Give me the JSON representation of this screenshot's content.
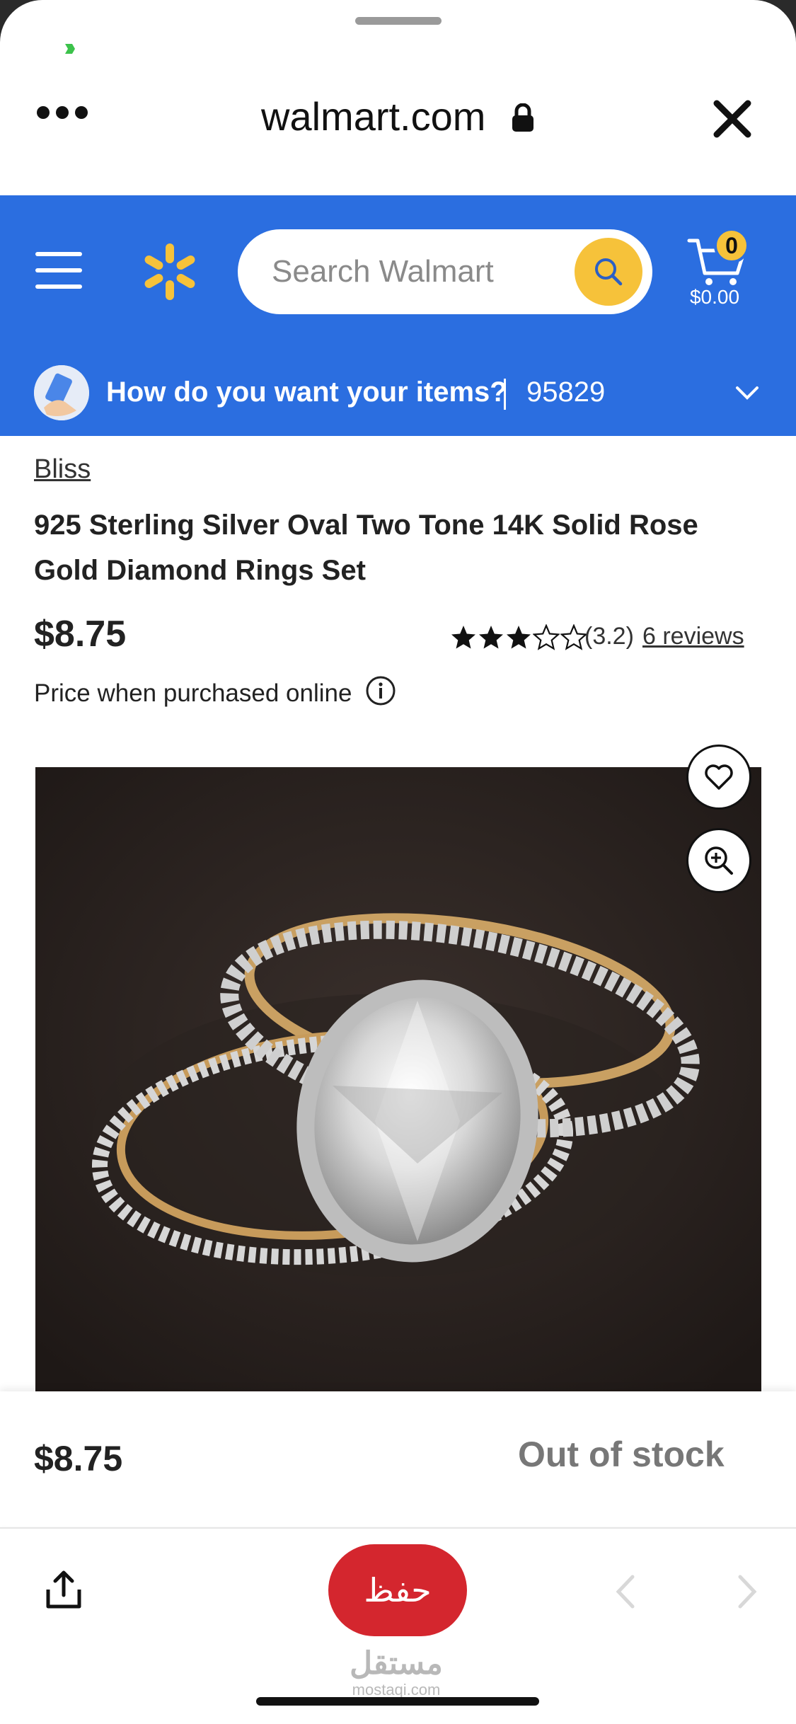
{
  "browser": {
    "url": "walmart.com",
    "more_icon": "more-dots-icon",
    "lock_icon": "lock-icon",
    "close_icon": "close-icon"
  },
  "header": {
    "menu_icon": "hamburger-icon",
    "logo_icon": "walmart-spark-icon",
    "search": {
      "placeholder": "Search Walmart",
      "value": ""
    },
    "cart": {
      "count": "0",
      "total": "$0.00"
    },
    "brand_color": "#2b6ee0",
    "accent_color": "#f6c23a"
  },
  "delivery": {
    "question": "How do you want your items?",
    "zip": "95829"
  },
  "product": {
    "brand": "Bliss",
    "title": "925 Sterling Silver Oval Two Tone 14K Solid Rose Gold Diamond Rings Set",
    "price": "$8.75",
    "rating": "(3.2)",
    "rating_value": 3.2,
    "rating_max": 5,
    "reviews": "6 reviews",
    "price_note": "Price when purchased online"
  },
  "bottom": {
    "price": "$8.75",
    "status": "Out of stock"
  },
  "tabbar": {
    "save_label": "حفظ",
    "watermark_ar": "مستقل",
    "watermark_latin": "mostaqi.com"
  }
}
